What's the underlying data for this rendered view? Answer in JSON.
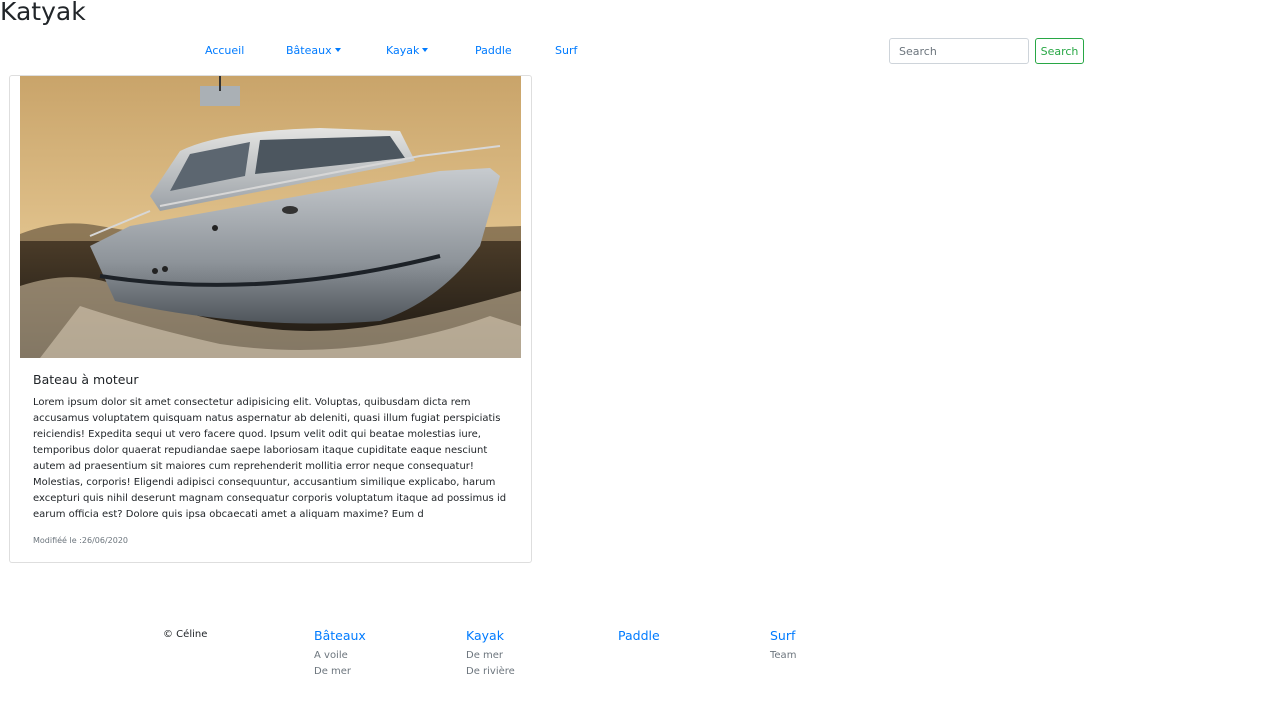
{
  "brand": "Katyak",
  "nav": {
    "items": [
      {
        "label": "Accueil"
      },
      {
        "label": "Bâteaux"
      },
      {
        "label": "Kayak"
      },
      {
        "label": "Paddle"
      },
      {
        "label": "Surf"
      }
    ]
  },
  "search": {
    "placeholder": "Search",
    "value": "",
    "button_label": "Search"
  },
  "card": {
    "image_alt": "Bateau à moteur",
    "title": "Bateau à moteur",
    "text": "Lorem ipsum dolor sit amet consectetur adipisicing elit. Voluptas, quibusdam dicta rem accusamus voluptatem quisquam natus aspernatur ab deleniti, quasi illum fugiat perspiciatis reiciendis! Expedita sequi ut vero facere quod. Ipsum velit odit qui beatae molestias iure, temporibus dolor quaerat repudiandae saepe laboriosam itaque cupiditate eaque nesciunt autem ad praesentium sit maiores cum reprehenderit mollitia error neque consequatur! Molestias, corporis! Eligendi adipisci consequuntur, accusantium similique explicabo, harum excepturi quis nihil deserunt magnam consequatur corporis voluptatum itaque ad possimus id earum officia est? Dolore quis ipsa obcaecati amet a aliquam maxime? Eum d",
    "footer": "Modifiéé le :26/06/2020"
  },
  "footer": {
    "copyright": "© Céline",
    "columns": [
      {
        "title": "Bâteaux",
        "links": [
          "A voile",
          "De mer"
        ]
      },
      {
        "title": "Kayak",
        "links": [
          "De mer",
          "De rivière"
        ]
      },
      {
        "title": "Paddle",
        "links": []
      },
      {
        "title": "Surf",
        "links": [
          "Team"
        ]
      }
    ]
  }
}
